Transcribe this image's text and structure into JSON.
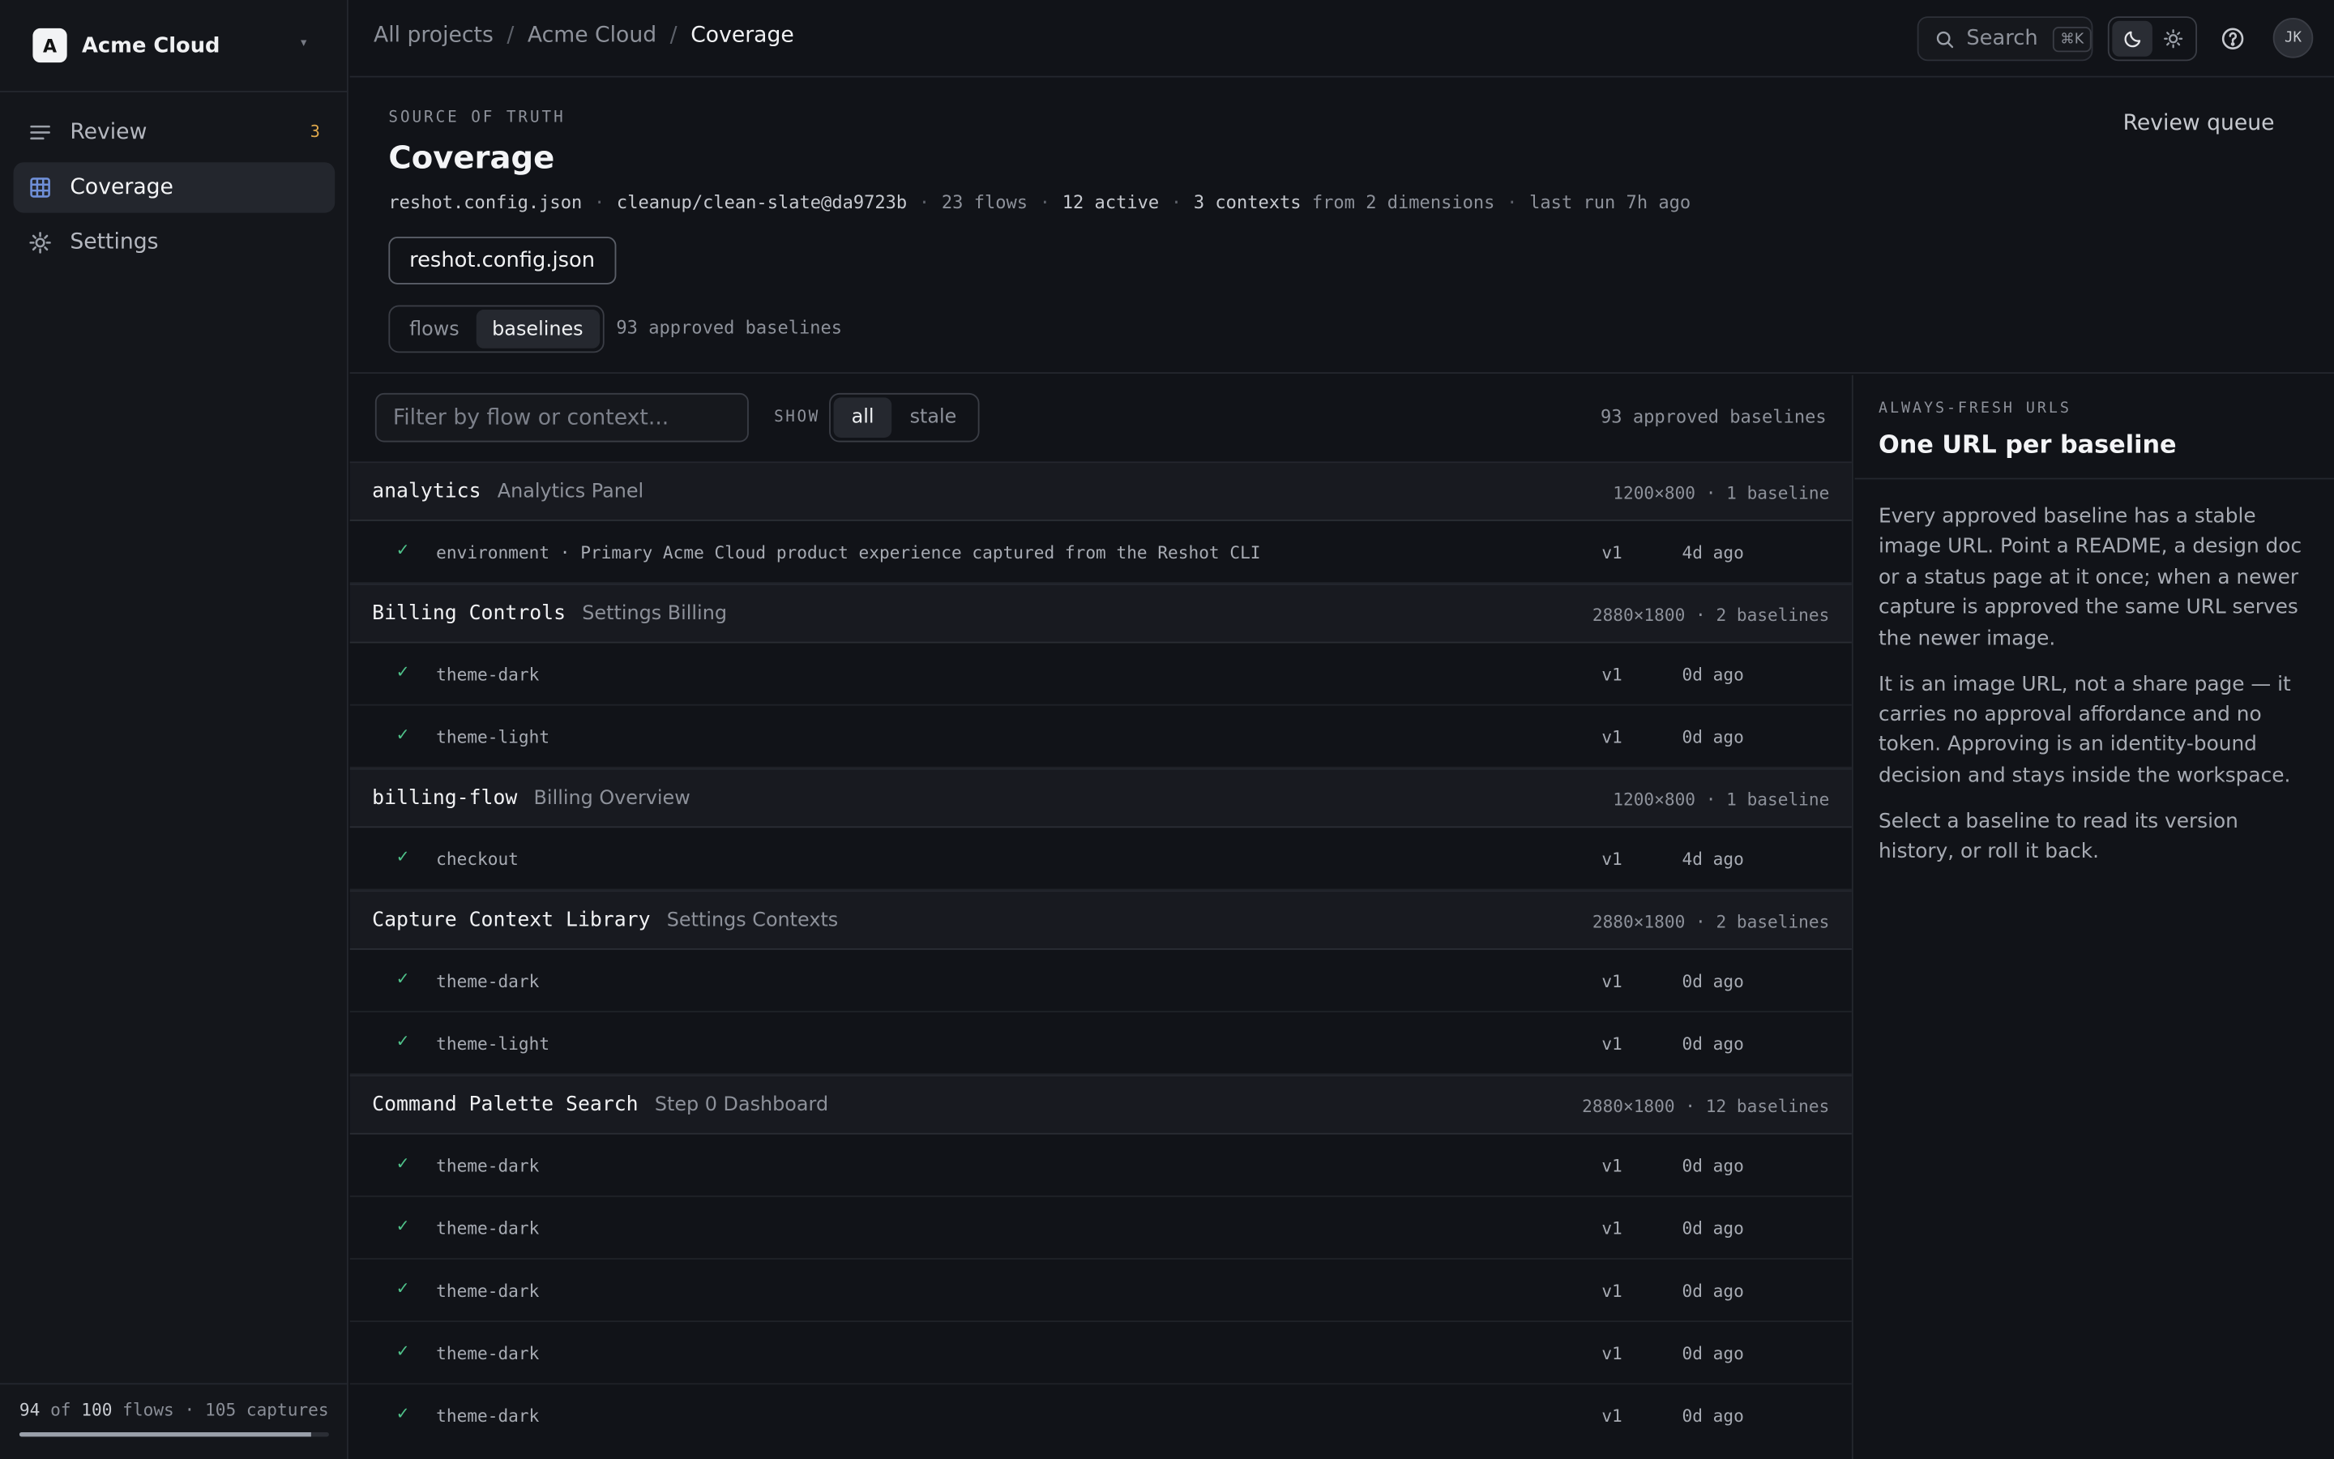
{
  "workspace": {
    "logo": "A",
    "name": "Acme Cloud",
    "caret": "▾"
  },
  "nav": [
    {
      "label": "Review",
      "icon": "list-icon",
      "badge": "3"
    },
    {
      "label": "Coverage",
      "icon": "grid-icon",
      "active": true
    },
    {
      "label": "Settings",
      "icon": "gear-icon"
    }
  ],
  "sidebar_footer": {
    "done": "94",
    "of": "of",
    "total": "100",
    "flows": "flows",
    "sep": "·",
    "captures": "105 captures",
    "progress_percent": 94
  },
  "breadcrumb": [
    "All projects",
    "Acme Cloud",
    "Coverage"
  ],
  "breadcrumb_sep": "/",
  "search": {
    "label": "Search",
    "shortcut": "⌘K"
  },
  "avatar": "JK",
  "header": {
    "eyebrow": "SOURCE OF TRUTH",
    "title": "Coverage",
    "meta": {
      "config": "reshot.config.json",
      "branch": "cleanup/clean-slate@da9723b",
      "flows": "23 flows",
      "active": "12 active",
      "contexts": "3 contexts",
      "dimensions": "from 2 dimensions",
      "last_run": "last run 7h ago",
      "sep": "·"
    },
    "config_button": "reshot.config.json",
    "view_tabs": [
      "flows",
      "baselines"
    ],
    "view_note": "93 approved baselines",
    "review_queue": "Review queue"
  },
  "list": {
    "filter_placeholder": "Filter by flow or context...",
    "show_label": "SHOW",
    "show_tabs": [
      "all",
      "stale"
    ],
    "count": "93 approved baselines",
    "check": "✓",
    "groups": [
      {
        "name": "analytics",
        "sub": "Analytics Panel",
        "dim": "1200×800 · 1 baseline",
        "rows": [
          {
            "ctx": "environment · Primary Acme Cloud product experience captured from the Reshot CLI",
            "ver": "v1",
            "age": "4d ago"
          }
        ]
      },
      {
        "name": "Billing Controls",
        "sub": "Settings Billing",
        "dim": "2880×1800 · 2 baselines",
        "rows": [
          {
            "ctx": "theme-dark",
            "ver": "v1",
            "age": "0d ago"
          },
          {
            "ctx": "theme-light",
            "ver": "v1",
            "age": "0d ago"
          }
        ]
      },
      {
        "name": "billing-flow",
        "sub": "Billing Overview",
        "dim": "1200×800 · 1 baseline",
        "rows": [
          {
            "ctx": "checkout",
            "ver": "v1",
            "age": "4d ago"
          }
        ]
      },
      {
        "name": "Capture Context Library",
        "sub": "Settings Contexts",
        "dim": "2880×1800 · 2 baselines",
        "rows": [
          {
            "ctx": "theme-dark",
            "ver": "v1",
            "age": "0d ago"
          },
          {
            "ctx": "theme-light",
            "ver": "v1",
            "age": "0d ago"
          }
        ]
      },
      {
        "name": "Command Palette Search",
        "sub": "Step 0 Dashboard",
        "dim": "2880×1800 · 12 baselines",
        "rows": [
          {
            "ctx": "theme-dark",
            "ver": "v1",
            "age": "0d ago"
          },
          {
            "ctx": "theme-dark",
            "ver": "v1",
            "age": "0d ago"
          },
          {
            "ctx": "theme-dark",
            "ver": "v1",
            "age": "0d ago"
          },
          {
            "ctx": "theme-dark",
            "ver": "v1",
            "age": "0d ago"
          },
          {
            "ctx": "theme-dark",
            "ver": "v1",
            "age": "0d ago"
          }
        ]
      }
    ]
  },
  "panel": {
    "eyebrow": "ALWAYS-FRESH URLS",
    "title": "One URL per baseline",
    "paragraphs": [
      "Every approved baseline has a stable image URL. Point a README, a design doc or a status page at it once; when a newer capture is approved the same URL serves the newer image.",
      "It is an image URL, not a share page — it carries no approval affordance and no token. Approving is an identity-bound decision and stays inside the workspace.",
      "Select a baseline to read its version history, or roll it back."
    ]
  },
  "colors": {
    "accent_check": "#4fc28a",
    "badge": "#e0a94b",
    "bg": "#111318"
  }
}
